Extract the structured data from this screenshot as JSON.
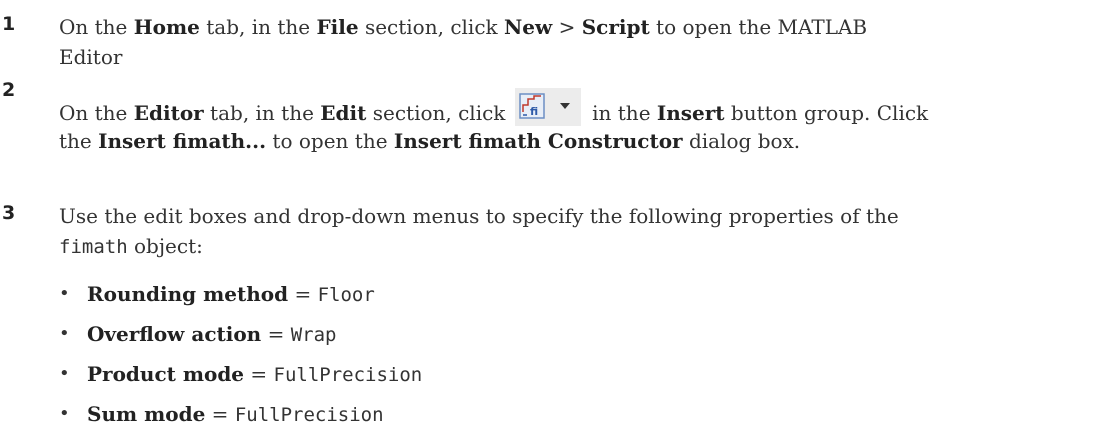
{
  "steps": [
    {
      "number": "1",
      "line1": {
        "t1": "On the ",
        "b1": "Home",
        "t2": " tab, in the ",
        "b2": "File",
        "t3": " section, click ",
        "b3": "New",
        "t4": " > ",
        "b4": "Script",
        "t5": " to open the MATLAB"
      },
      "line2": "Editor"
    },
    {
      "number": "2",
      "line1": {
        "t1": "On the ",
        "b1": "Editor",
        "t2": " tab, in the ",
        "b2": "Edit",
        "t3": " section, click ",
        "t4": " in the ",
        "b3": "Insert",
        "t5": " button group. Click"
      },
      "line2": {
        "t1": "the ",
        "b1": "Insert fimath...",
        "t2": " to open the ",
        "b2": "Insert fimath Constructor",
        "t3": " dialog box."
      },
      "button_icon": "insert-fimath-icon",
      "button_arrow": "dropdown-arrow-icon"
    },
    {
      "number": "3",
      "line1": "Use the edit boxes and drop-down menus to specify the following properties of the",
      "line2": {
        "code": "fimath",
        "t1": " object:"
      },
      "bullet": "•",
      "properties": [
        {
          "name": "Rounding method",
          "eq": " = ",
          "value": "Floor"
        },
        {
          "name": "Overflow action",
          "eq": " = ",
          "value": "Wrap"
        },
        {
          "name": "Product mode",
          "eq": " = ",
          "value": "FullPrecision"
        },
        {
          "name": "Sum mode",
          "eq": " = ",
          "value": "FullPrecision"
        }
      ]
    }
  ],
  "colors": {
    "text": "#333333",
    "icon_border": "#6c8fc4",
    "icon_bg": "#e8eef7"
  }
}
